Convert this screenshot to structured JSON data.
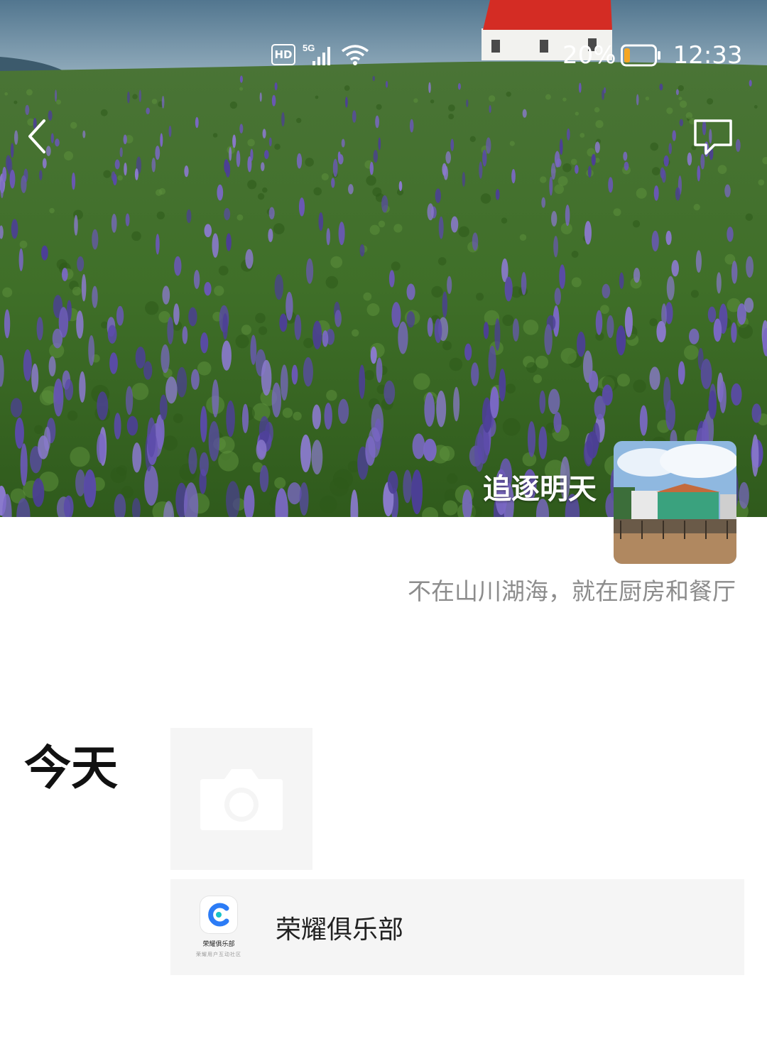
{
  "status_bar": {
    "hd": "HD",
    "network": "5G",
    "battery_percent": "20%",
    "time": "12:33",
    "icons": [
      "hd-icon",
      "signal-5g-icon",
      "wifi-icon",
      "battery-icon"
    ],
    "battery_level": 0.2
  },
  "nav": {
    "back_icon": "chevron-left-icon",
    "message_icon": "message-icon"
  },
  "profile": {
    "name": "追逐明天",
    "signature": "不在山川湖海，就在厨房和餐厅"
  },
  "feed": {
    "day_label": "今天",
    "camera_icon": "camera-icon",
    "share_card": {
      "title": "荣耀俱乐部",
      "thumb_name": "荣耀俱乐部",
      "thumb_subtitle": "荣耀用户互动社区"
    }
  },
  "colors": {
    "brand_blue": "#2c7cf6",
    "roof_red": "#d42c24",
    "lupine_purple": "#6a58b6",
    "feed_bg": "#f5f5f5",
    "signature_gray": "#8c8c8c"
  }
}
